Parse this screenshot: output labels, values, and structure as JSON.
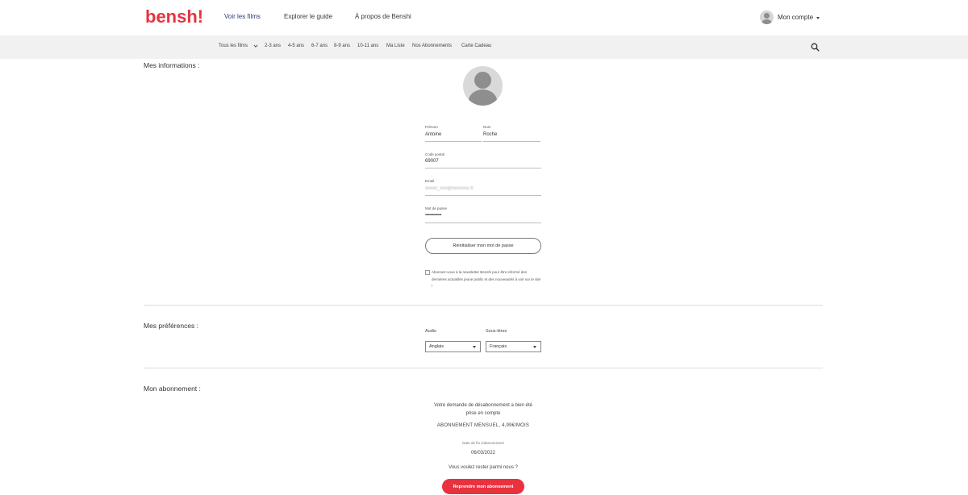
{
  "brand": {
    "logo_text": "bensh!",
    "accent_color": "#e8323e",
    "nav_active_color": "#2d3a6e"
  },
  "topnav": {
    "items": [
      {
        "label": "Voir les films"
      },
      {
        "label": "Explorer le guide"
      },
      {
        "label": "À propos de Benshi"
      }
    ],
    "account_label": "Mon compte"
  },
  "subnav": {
    "items": [
      {
        "label": "Tous les films"
      },
      {
        "label": "2-3 ans"
      },
      {
        "label": "4-5 ans"
      },
      {
        "label": "6-7 ans"
      },
      {
        "label": "8-9 ans"
      },
      {
        "label": "10-11 ans"
      },
      {
        "label": "Ma Liste"
      },
      {
        "label": "Nos Abonnements"
      },
      {
        "label": "Carte Cadeau"
      }
    ]
  },
  "info": {
    "title": "Mes informations :",
    "firstname": {
      "label": "Prénom",
      "value": "Antoine"
    },
    "lastname": {
      "label": "Nom",
      "value": "Roche"
    },
    "postal": {
      "label": "Code postal",
      "value": "69007"
    },
    "email": {
      "label": "Email",
      "value": "xxxxx_xxx@xxxxxxx.fr"
    },
    "password": {
      "label": "Mot de passe",
      "value": "••••••••••••••••"
    },
    "reset_button": "Réinitialiser mon mot de passe",
    "newsletter_text": "Abonnez-vous à la newsletter Benshi pour être informé des dernières actualités jeune public et des nouveautés à voir sur le site !"
  },
  "preferences": {
    "title": "Mes préférences :",
    "audio": {
      "label": "Audio",
      "value": "Anglais"
    },
    "subtitles": {
      "label": "Sous-titres",
      "value": "Français"
    }
  },
  "subscription": {
    "title": "Mon abonnement :",
    "message": "Votre demande de désabonnement a bien été prise en compte",
    "plan": "ABONNEMENT MENSUEL, 4,99€/MOIS",
    "end_label": "Date de fin d'abonnement",
    "end_date": "06/03/2022",
    "stay_text": "Vous voulez rester parmi nous ?",
    "resume_button": "Reprendre mon abonnement"
  }
}
